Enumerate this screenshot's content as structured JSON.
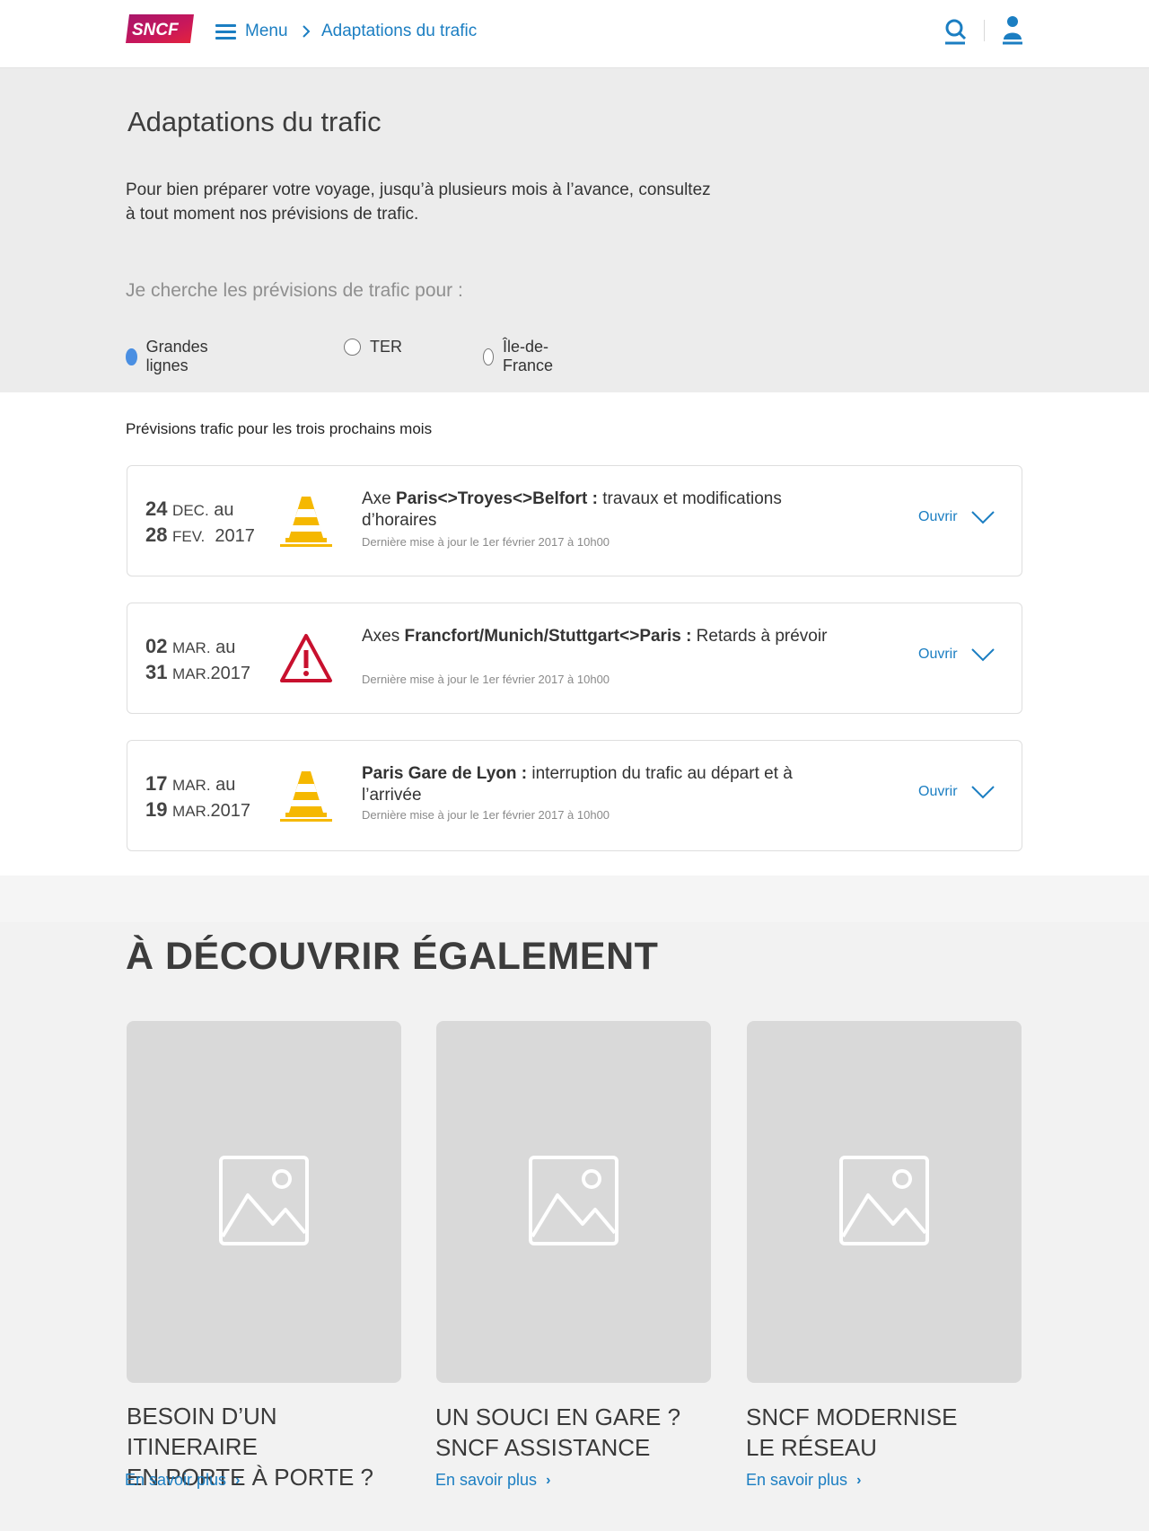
{
  "header": {
    "logo_text": "SNCF",
    "menu_label": "Menu",
    "breadcrumb_current": "Adaptations du trafic"
  },
  "intro": {
    "title": "Adaptations du trafic",
    "text": "Pour bien préparer votre voyage, jusqu’à plusieurs mois à l’avance, consultez à tout moment nos prévisions de trafic.",
    "search_label": "Je cherche les prévisions de trafic pour :",
    "radios": [
      {
        "label": "Grandes lignes",
        "checked": true
      },
      {
        "label": "TER",
        "checked": false
      },
      {
        "label": "Île-de-France",
        "checked": false
      }
    ]
  },
  "forecast": {
    "heading": "Prévisions trafic pour les trois prochains mois",
    "open_label": "Ouvrir",
    "cards": [
      {
        "icon": "traffic-cone-icon",
        "start_day": "24",
        "start_month": "DEC.",
        "connector": "au",
        "end_day": "28",
        "end_month": "FEV.",
        "year": "2017",
        "title_prefix": "Axe ",
        "title_bold": "Paris<>Troyes<>Belfort :",
        "title_rest": " travaux et modifications d’horaires",
        "update": "Dernière mise à jour le 1er février 2017 à 10h00"
      },
      {
        "icon": "warning-triangle-icon",
        "start_day": "02",
        "start_month": "MAR.",
        "connector": "au",
        "end_day": "31",
        "end_month": "MAR.",
        "year": "2017",
        "title_prefix": "Axes ",
        "title_bold": "Francfort/Munich/Stuttgart<>Paris :",
        "title_rest": " Retards à prévoir",
        "update": "Dernière mise à jour le 1er février 2017 à 10h00"
      },
      {
        "icon": "traffic-cone-icon",
        "start_day": "17",
        "start_month": "MAR.",
        "connector": "au",
        "end_day": "19",
        "end_month": "MAR.",
        "year": "2017",
        "title_prefix": "",
        "title_bold": "Paris Gare de Lyon :",
        "title_rest": " interruption du trafic au départ et à l’arrivée",
        "update": "Dernière mise à jour le 1er février 2017 à 10h00"
      }
    ]
  },
  "discover": {
    "title": "À DÉCOUVRIR ÉGALEMENT",
    "link_label": "En savoir plus",
    "tiles": [
      {
        "line1": "BESOIN D’UN ITINERAIRE",
        "line2": "EN PORTE À PORTE ?"
      },
      {
        "line1": "UN SOUCI EN GARE ?",
        "line2": "SNCF ASSISTANCE"
      },
      {
        "line1": "SNCF MODERNISE",
        "line2": "LE RÉSEAU"
      }
    ]
  },
  "colors": {
    "accent": "#1b7ec2",
    "radio_checked": "#4a8fe2",
    "cone": "#f5b800",
    "warning": "#c8102e"
  }
}
